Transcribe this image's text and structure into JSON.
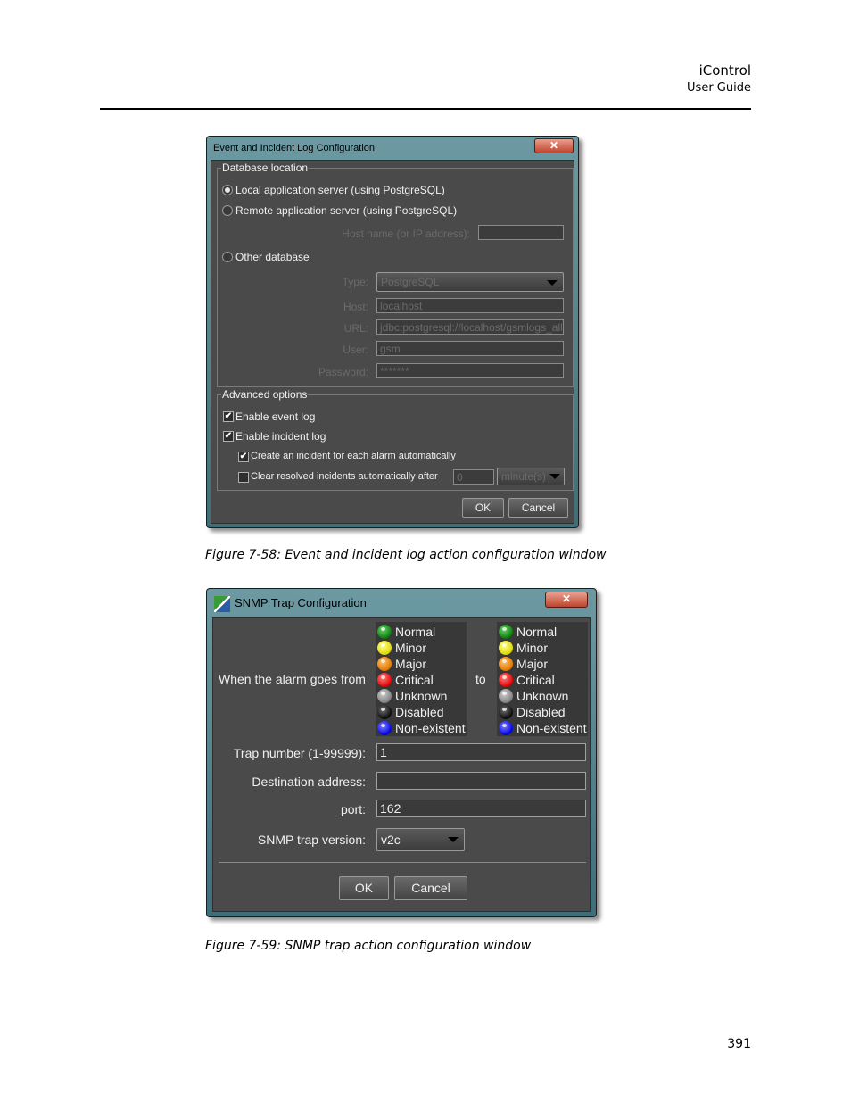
{
  "header": {
    "product": "iControl",
    "doc": "User Guide"
  },
  "page_number": "391",
  "figure1": {
    "caption": "Figure 7-58:  Event and incident log action configuration window",
    "title": "Event and Incident Log Configuration",
    "close_glyph": "✕",
    "db_location_legend": "Database location",
    "radio_local": "Local application server (using PostgreSQL)",
    "radio_remote": "Remote application server (using PostgreSQL)",
    "host_label": "Host name (or IP address):",
    "host_value": "",
    "radio_other": "Other database",
    "type_label": "Type:",
    "type_value": "PostgreSQL",
    "host2_label": "Host:",
    "host2_value": "localhost",
    "url_label": "URL:",
    "url_value": "jdbc:postgresql://localhost/gsmlogs_all",
    "user_label": "User:",
    "user_value": "gsm",
    "password_label": "Password:",
    "password_value": "*******",
    "advanced_legend": "Advanced options",
    "enable_event_log": "Enable event log",
    "enable_incident_log": "Enable incident log",
    "create_incident": "Create an incident for each alarm automatically",
    "clear_resolved": "Clear resolved incidents automatically after",
    "clear_value": "0",
    "clear_unit": "minute(s)",
    "check_glyph": "✔",
    "ok": "OK",
    "cancel": "Cancel"
  },
  "figure2": {
    "caption": "Figure 7-59:  SNMP trap action configuration window",
    "title": "SNMP Trap Configuration",
    "close_glyph": "✕",
    "from_label": "When the alarm goes from",
    "to_label": "to",
    "severities": [
      "Normal",
      "Minor",
      "Major",
      "Critical",
      "Unknown",
      "Disabled",
      "Non-existent"
    ],
    "trap_label": "Trap number (1-99999):",
    "trap_value": "1",
    "dest_label": "Destination address:",
    "dest_value": "",
    "port_label": "port:",
    "port_value": "162",
    "version_label": "SNMP trap version:",
    "version_value": "v2c",
    "ok": "OK",
    "cancel": "Cancel"
  }
}
